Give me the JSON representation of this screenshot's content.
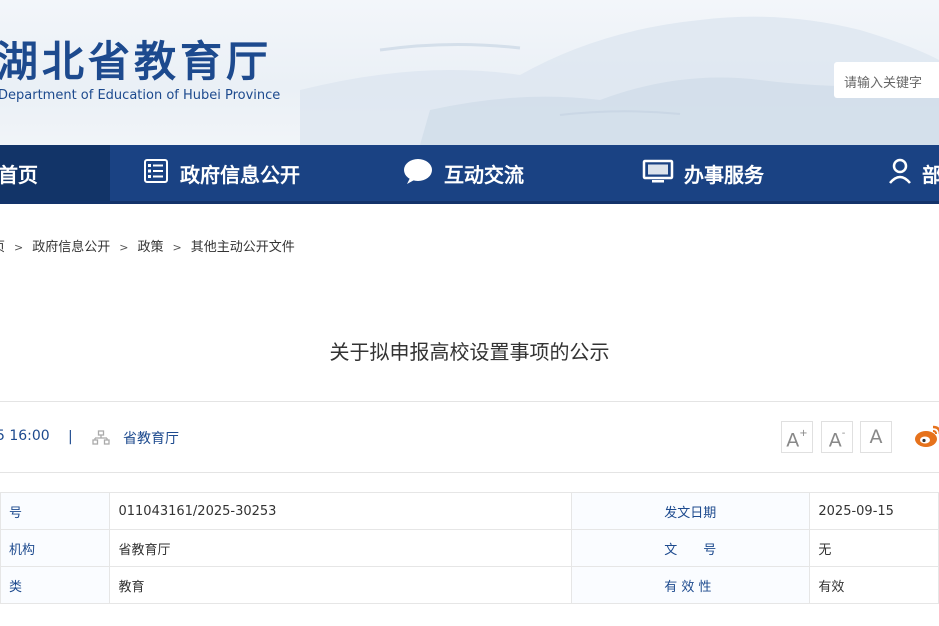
{
  "header": {
    "site_name_cn": "湖北省教育厅",
    "site_name_en": "Department of Education of Hubei Province",
    "search_placeholder": "请输入关键字"
  },
  "nav": {
    "items": [
      {
        "label": "首页",
        "icon": "none"
      },
      {
        "label": "政府信息公开",
        "icon": "document-list-icon"
      },
      {
        "label": "互动交流",
        "icon": "speech-bubble-icon"
      },
      {
        "label": "办事服务",
        "icon": "monitor-icon"
      },
      {
        "label": "部",
        "icon": "person-badge-icon"
      }
    ]
  },
  "breadcrumb": {
    "items": [
      "页",
      "政府信息公开",
      "政策",
      "其他主动公开文件"
    ],
    "separator": ">"
  },
  "article": {
    "title": "关于拟申报高校设置事项的公示",
    "date": "5 16:00",
    "divider": "|",
    "org": "省教育厅"
  },
  "font_controls": {
    "increase": "A",
    "increase_mark": "+",
    "decrease": "A",
    "decrease_mark": "-",
    "reset": "A"
  },
  "info_table": {
    "rows": [
      {
        "label1": "号",
        "value1": "011043161/2025-30253",
        "label2": "发文日期",
        "value2": "2025-09-15"
      },
      {
        "label1": "机构",
        "value1": "省教育厅",
        "label2": "文　　号",
        "value2": "无"
      },
      {
        "label1": "类",
        "value1": "教育",
        "label2": "有 效 性",
        "value2": "有效"
      }
    ]
  },
  "colors": {
    "brand_blue": "#1d4a8e",
    "nav_bg": "#1a4283",
    "nav_active": "#123468",
    "weibo_orange": "#e6721c"
  }
}
